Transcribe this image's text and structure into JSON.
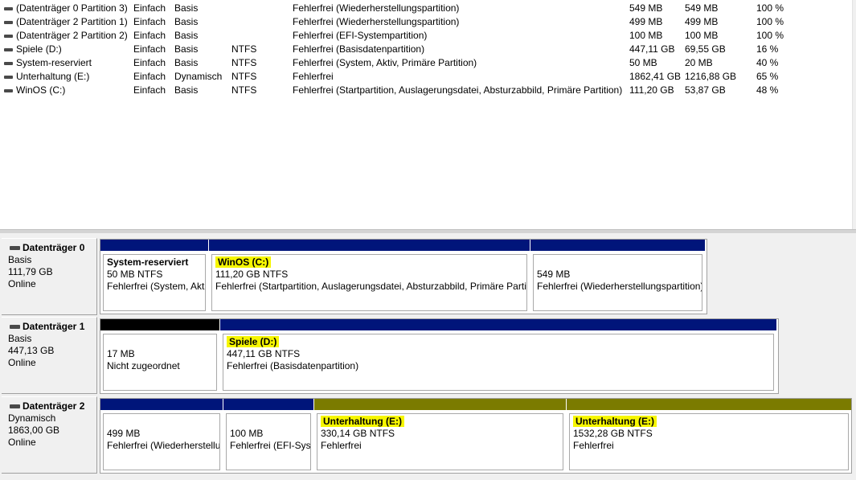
{
  "volumes": [
    {
      "name": "(Datenträger 0 Partition 3)",
      "layout": "Einfach",
      "type": "Basis",
      "fs": "",
      "status": "Fehlerfrei (Wiederherstellungspartition)",
      "capacity": "549 MB",
      "free": "549 MB",
      "pct": "100 %"
    },
    {
      "name": "(Datenträger 2 Partition 1)",
      "layout": "Einfach",
      "type": "Basis",
      "fs": "",
      "status": "Fehlerfrei (Wiederherstellungspartition)",
      "capacity": "499 MB",
      "free": "499 MB",
      "pct": "100 %"
    },
    {
      "name": "(Datenträger 2 Partition 2)",
      "layout": "Einfach",
      "type": "Basis",
      "fs": "",
      "status": "Fehlerfrei (EFI-Systempartition)",
      "capacity": "100 MB",
      "free": "100 MB",
      "pct": "100 %"
    },
    {
      "name": "Spiele (D:)",
      "layout": "Einfach",
      "type": "Basis",
      "fs": "NTFS",
      "status": "Fehlerfrei (Basisdatenpartition)",
      "capacity": "447,11 GB",
      "free": "69,55 GB",
      "pct": "16 %"
    },
    {
      "name": "System-reserviert",
      "layout": "Einfach",
      "type": "Basis",
      "fs": "NTFS",
      "status": "Fehlerfrei (System, Aktiv, Primäre Partition)",
      "capacity": "50 MB",
      "free": "20 MB",
      "pct": "40 %"
    },
    {
      "name": "Unterhaltung (E:)",
      "layout": "Einfach",
      "type": "Dynamisch",
      "fs": "NTFS",
      "status": "Fehlerfrei",
      "capacity": "1862,41 GB",
      "free": "1216,88 GB",
      "pct": "65 %"
    },
    {
      "name": "WinOS (C:)",
      "layout": "Einfach",
      "type": "Basis",
      "fs": "NTFS",
      "status": "Fehlerfrei (Startpartition, Auslagerungsdatei, Absturzabbild, Primäre Partition)",
      "capacity": "111,20 GB",
      "free": "53,87 GB",
      "pct": "48 %"
    }
  ],
  "disks": [
    {
      "name": "Datenträger 0",
      "type": "Basis",
      "size": "111,79 GB",
      "state": "Online",
      "partitions": [
        {
          "title": "System-reserviert",
          "size": "50 MB NTFS",
          "status": "Fehlerfrei (System, Aktiv, Primäre Partition)"
        },
        {
          "title": "WinOS  (C:)",
          "size": "111,20 GB NTFS",
          "status": "Fehlerfrei (Startpartition, Auslagerungsdatei, Absturzabbild, Primäre Partition)"
        },
        {
          "size": "549 MB",
          "status": "Fehlerfrei (Wiederherstellungspartition)"
        }
      ]
    },
    {
      "name": "Datenträger 1",
      "type": "Basis",
      "size": "447,13 GB",
      "state": "Online",
      "partitions": [
        {
          "size": "17 MB",
          "status": "Nicht zugeordnet"
        },
        {
          "title": "Spiele  (D:)",
          "size": "447,11 GB NTFS",
          "status": "Fehlerfrei (Basisdatenpartition)"
        }
      ]
    },
    {
      "name": "Datenträger 2",
      "type": "Dynamisch",
      "size": "1863,00 GB",
      "state": "Online",
      "partitions": [
        {
          "size": "499 MB",
          "status": "Fehlerfrei (Wiederherstellungspartition)"
        },
        {
          "size": "100 MB",
          "status": "Fehlerfrei (EFI-Systempartition)"
        },
        {
          "title": "Unterhaltung  (E:)",
          "size": "330,14 GB NTFS",
          "status": "Fehlerfrei"
        },
        {
          "title": "Unterhaltung  (E:)",
          "size": "1532,28 GB NTFS",
          "status": "Fehlerfrei"
        }
      ]
    }
  ],
  "colors": {
    "primary_partition": "#00157a",
    "unallocated": "#000000",
    "simple_volume": "#7b7b00",
    "highlight": "#f6f600"
  }
}
